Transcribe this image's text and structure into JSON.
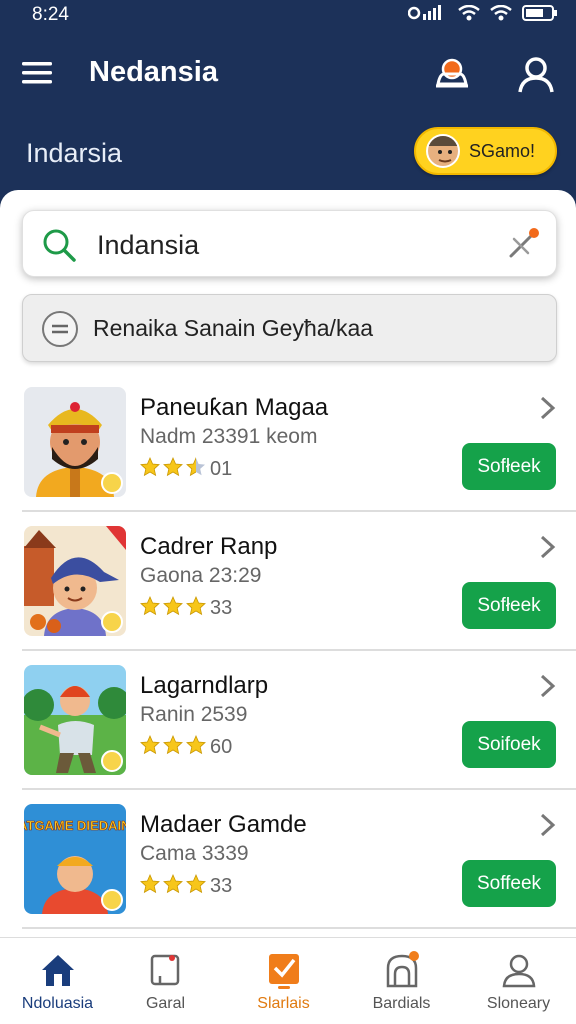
{
  "status_bar": {
    "time": "8:24"
  },
  "header": {
    "app_title": "Nedansia",
    "subtitle": "Indarsia",
    "game_badge": "SGamo!"
  },
  "search": {
    "value": "Indansia",
    "placeholder": "Indansia"
  },
  "filter": {
    "label": "Renaika Sanain Geyħa/kaa"
  },
  "games": [
    {
      "title": "Paneuƙan Magaa",
      "meta": "Nadm 23391 keom",
      "stars": 2.5,
      "rating_text": "01",
      "button": "Sofłeek"
    },
    {
      "title": "Cadrer Ranp",
      "meta": "Gaona 23:29",
      "stars": 3,
      "rating_text": "33",
      "button": "Sofłeek"
    },
    {
      "title": "Lagarndlarp",
      "meta": "Ranin 2539",
      "stars": 3,
      "rating_text": "60",
      "button": "Soifoek"
    },
    {
      "title": "Madaer Gamde",
      "meta": "Cama 3339",
      "stars": 3,
      "rating_text": "33",
      "button": "Soffeek"
    }
  ],
  "thumb4_banner": "TRATGAME DIEDAINOS",
  "tabs": [
    {
      "label": "Ndoluasia",
      "icon": "home-icon"
    },
    {
      "label": "Garal",
      "icon": "flag-icon"
    },
    {
      "label": "Slarlais",
      "icon": "checklist-icon"
    },
    {
      "label": "Bardials",
      "icon": "badge-icon"
    },
    {
      "label": "Sloneary",
      "icon": "user-icon"
    }
  ],
  "colors": {
    "header": "#1c3159",
    "accent_green": "#15a24a",
    "badge_yellow": "#ffd21f",
    "star": "#f7c61a",
    "active_tab": "#1a3d7c",
    "orange": "#e07a10"
  }
}
